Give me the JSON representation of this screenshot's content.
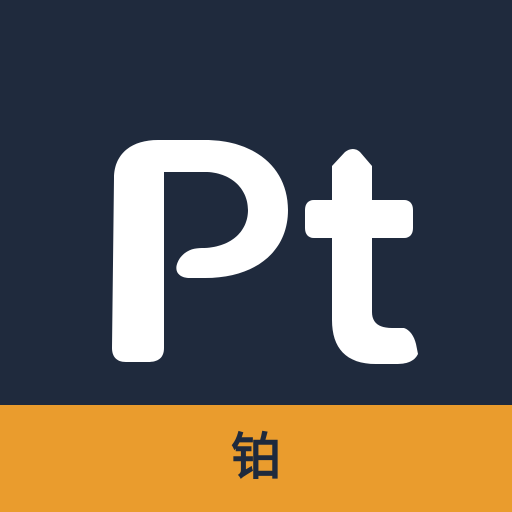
{
  "icon": {
    "symbol": "Pt",
    "character": "铂",
    "colors": {
      "panel": "#1f2a3d",
      "band": "#ea9c2d",
      "glyph": "#ffffff",
      "character": "#1f2a3d"
    }
  }
}
